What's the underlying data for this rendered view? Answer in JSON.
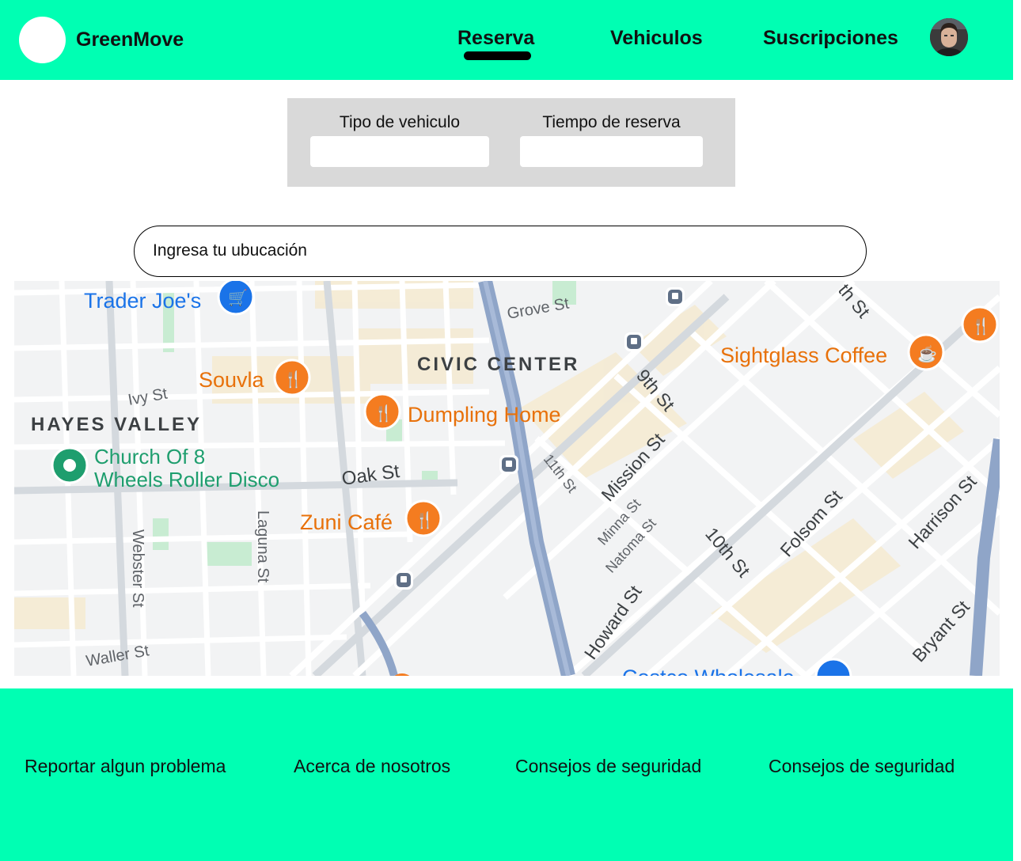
{
  "header": {
    "brand": "GreenMove",
    "nav": [
      {
        "label": "Reserva",
        "active": true
      },
      {
        "label": "Vehiculos",
        "active": false
      },
      {
        "label": "Suscripciones",
        "active": false
      }
    ]
  },
  "booking": {
    "vehicle_type_label": "Tipo de vehiculo",
    "vehicle_type_value": "",
    "reservation_time_label": "Tiempo de reserva",
    "reservation_time_value": ""
  },
  "search": {
    "placeholder": "Ingresa tu ubucación"
  },
  "map": {
    "districts": [
      "CIVIC CENTER",
      "HAYES VALLEY"
    ],
    "places": {
      "trader_joes": "Trader Joe's",
      "souvla": "Souvla",
      "dumpling_home": "Dumpling Home",
      "sightglass": "Sightglass Coffee",
      "church_line1": "Church Of 8",
      "church_line2": "Wheels Roller Disco",
      "zuni": "Zuni Café",
      "costco_partial": "Costco Wholesale"
    },
    "streets": {
      "grove": "Grove St",
      "ivy": "Ivy St",
      "oak": "Oak St",
      "ninth": "9th St",
      "mission": "Mission St",
      "eleventh": "11th St",
      "minna": "Minna St",
      "natoma": "Natoma St",
      "laguna": "Laguna St",
      "webster": "Webster St",
      "waller": "Waller St",
      "howard": "Howard St",
      "tenth": "10th St",
      "folsom": "Folsom St",
      "harrison": "Harrison St",
      "bryant": "Bryant St",
      "eighth_partial": "th St"
    },
    "colors": {
      "restaurant": "#f47c20",
      "shop": "#1a73e8",
      "attraction": "#1e9e6e",
      "transit": "#5f6f86",
      "highway": "#8fa5c8"
    }
  },
  "footer": {
    "links": [
      "Reportar algun problema",
      "Acerca de nosotros",
      "Consejos de seguridad",
      "Consejos de seguridad"
    ]
  },
  "colors": {
    "brand_green": "#00ffb3",
    "panel_gray": "#d9d9d9"
  }
}
